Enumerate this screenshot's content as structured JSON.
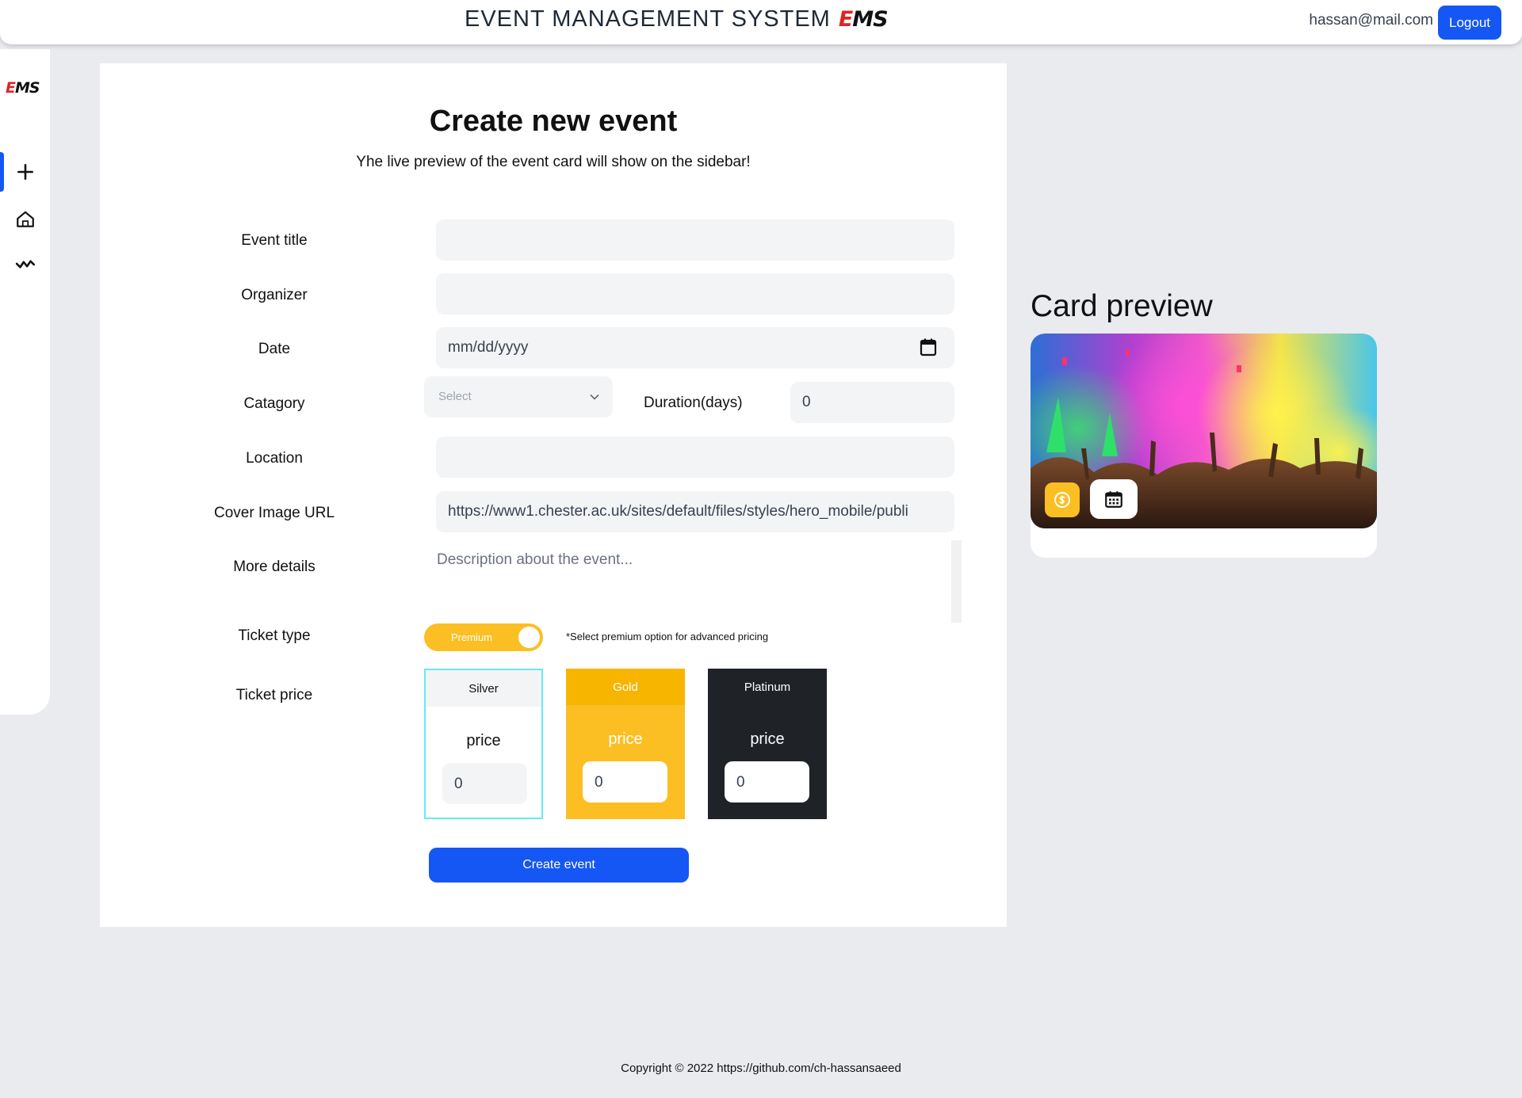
{
  "header": {
    "app_title": "EVENT MANAGEMENT SYSTEM",
    "logo_text_e": "E",
    "logo_text_rest": "MS",
    "user_email": "hassan@mail.com",
    "logout_label": "Logout"
  },
  "sidebar": {
    "logo_text_e": "E",
    "logo_text_rest": "MS",
    "items": [
      {
        "icon": "plus-icon",
        "active": true
      },
      {
        "icon": "home-icon",
        "active": false
      },
      {
        "icon": "activity-icon",
        "active": false
      }
    ]
  },
  "form": {
    "title": "Create new event",
    "subtitle": "Yhe live preview of the event card will show on the sidebar!",
    "labels": {
      "event_title": "Event title",
      "organizer": "Organizer",
      "date": "Date",
      "category": "Catagory",
      "location": "Location",
      "cover_image_url": "Cover Image URL",
      "more_details": "More details",
      "ticket_type": "Ticket type",
      "ticket_price": "Ticket price",
      "duration": "Duration(days)"
    },
    "values": {
      "event_title": "",
      "organizer": "",
      "date_placeholder": "mm/dd/yyyy",
      "category": "Select",
      "duration": "0",
      "location": "",
      "cover_image_url": "https://www1.chester.ac.uk/sites/default/files/styles/hero_mobile/publi",
      "details_placeholder": "Description about the event..."
    },
    "ticket_type": {
      "toggle_label": "Premium",
      "is_premium": true,
      "note": "*Select premium option for advanced pricing"
    },
    "tiers": [
      {
        "name": "Silver",
        "price_label": "price",
        "value": "0"
      },
      {
        "name": "Gold",
        "price_label": "price",
        "value": "0"
      },
      {
        "name": "Platinum",
        "price_label": "price",
        "value": "0"
      }
    ],
    "submit_label": "Create event"
  },
  "preview": {
    "heading": "Card preview",
    "price_icon": "dollar-coin-icon",
    "date_icon": "calendar-icon"
  },
  "colors": {
    "primary": "#1557f5",
    "accent": "#fbbf24",
    "dark": "#1f2328",
    "logo_red": "#dc2626"
  },
  "footer": {
    "copyright": "Copyright © 2022 https://github.com/ch-hassansaeed"
  }
}
